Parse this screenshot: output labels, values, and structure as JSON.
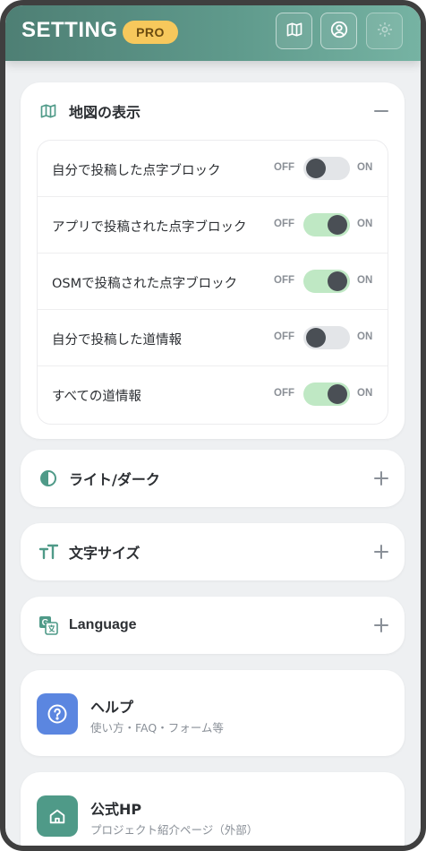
{
  "header": {
    "title": "SETTING",
    "badge": "PRO",
    "buttons": [
      {
        "icon": "map-icon"
      },
      {
        "icon": "user-icon"
      },
      {
        "icon": "gear-icon"
      }
    ]
  },
  "map_section": {
    "icon": "map-icon",
    "title": "地図の表示",
    "expanded": true,
    "toggles": [
      {
        "label": "自分で投稿した点字ブロック",
        "off": "OFF",
        "on": "ON",
        "state": false
      },
      {
        "label": "アプリで投稿された点字ブロック",
        "off": "OFF",
        "on": "ON",
        "state": true
      },
      {
        "label": "OSMで投稿された点字ブロック",
        "off": "OFF",
        "on": "ON",
        "state": true
      },
      {
        "label": "自分で投稿した道情報",
        "off": "OFF",
        "on": "ON",
        "state": false
      },
      {
        "label": "すべての道情報",
        "off": "OFF",
        "on": "ON",
        "state": true
      }
    ]
  },
  "sections": [
    {
      "icon": "contrast-icon",
      "title": "ライト/ダーク"
    },
    {
      "icon": "text-size-icon",
      "title": "文字サイズ"
    },
    {
      "icon": "translate-icon",
      "title": "Language"
    }
  ],
  "links": [
    {
      "icon": "help-icon",
      "title": "ヘルプ",
      "subtitle": "使い方・FAQ・フォーム等",
      "color": "#5b86e0"
    },
    {
      "icon": "home-icon",
      "title": "公式HP",
      "subtitle": "プロジェクト紹介ページ（外部）",
      "color": "#4f9a88"
    }
  ],
  "colors": {
    "accent": "#4f9a88",
    "toggle_on": "#bfe8c4",
    "toggle_off": "#e3e5e8"
  }
}
